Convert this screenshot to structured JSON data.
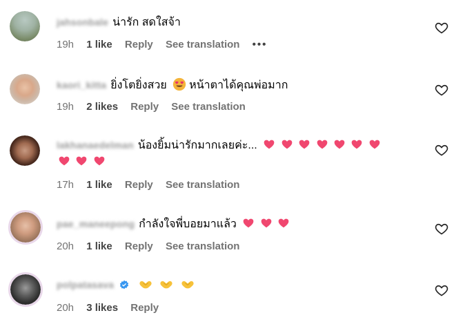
{
  "comments": [
    {
      "username": "jahsonbale",
      "text": "น่ารัก สดใสจ้า",
      "time": "19h",
      "likes": "1 like",
      "reply": "Reply",
      "translate": "See translation",
      "more": "•••"
    },
    {
      "username": "kaori_kitta",
      "text_before": "ยิ่งโตยิ่งสวย",
      "text_after": "หน้าตาได้คุณพ่อมาก",
      "time": "19h",
      "likes": "2 likes",
      "reply": "Reply",
      "translate": "See translation"
    },
    {
      "username": "lakhanaedelman",
      "text": "น้องยิ้มน่ารักมากเลยค่ะ...",
      "time": "17h",
      "likes": "1 like",
      "reply": "Reply",
      "translate": "See translation"
    },
    {
      "username": "pae_maneepong",
      "text": "กำลังใจพี่บอยมาแล้ว",
      "time": "20h",
      "likes": "1 like",
      "reply": "Reply",
      "translate": "See translation"
    },
    {
      "username": "polpatasava",
      "time": "20h",
      "likes": "3 likes",
      "reply": "Reply"
    }
  ],
  "colors": {
    "heart_pink": "#f0476f",
    "meta_gray": "#737373",
    "username_gray": "#9a9a9a",
    "verified_blue": "#3897f0",
    "hand_yellow": "#f7c23a"
  },
  "icons": {
    "like": "heart-outline-icon",
    "emoji_heart": "pink-heart-emoji",
    "emoji_smiley": "heart-eyes-emoji",
    "emoji_hands": "hand-heart-emoji",
    "verified": "verified-badge-icon"
  }
}
